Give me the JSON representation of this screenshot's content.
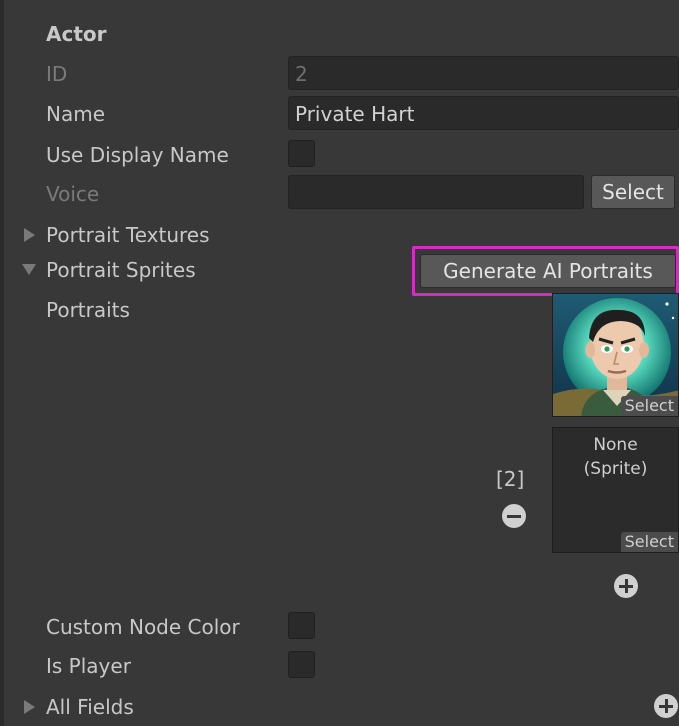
{
  "actor": {
    "section_title": "Actor",
    "id_label": "ID",
    "id_value": "2",
    "name_label": "Name",
    "name_value": "Private Hart",
    "use_display_name_label": "Use Display Name",
    "voice_label": "Voice",
    "voice_value": "",
    "voice_select_label": "Select",
    "portrait_textures_label": "Portrait Textures",
    "portrait_sprites_label": "Portrait Sprites",
    "generate_button_label": "Generate AI Portraits",
    "portraits_label": "Portraits",
    "portrait_slot_select_label": "Select",
    "portrait_index_label": "[2]",
    "empty_slot_text_line1": "None",
    "empty_slot_text_line2": "(Sprite)",
    "empty_slot_select_label": "Select",
    "custom_node_color_label": "Custom Node Color",
    "is_player_label": "Is Player",
    "all_fields_label": "All Fields"
  },
  "colors": {
    "highlight": "#d02fbf",
    "panel_bg": "#383838",
    "field_bg": "#2a2a2a"
  },
  "icons": {
    "collapsed": "triangle-right-icon",
    "expanded": "triangle-down-icon",
    "remove": "minus-circle-icon",
    "add": "plus-circle-icon"
  }
}
